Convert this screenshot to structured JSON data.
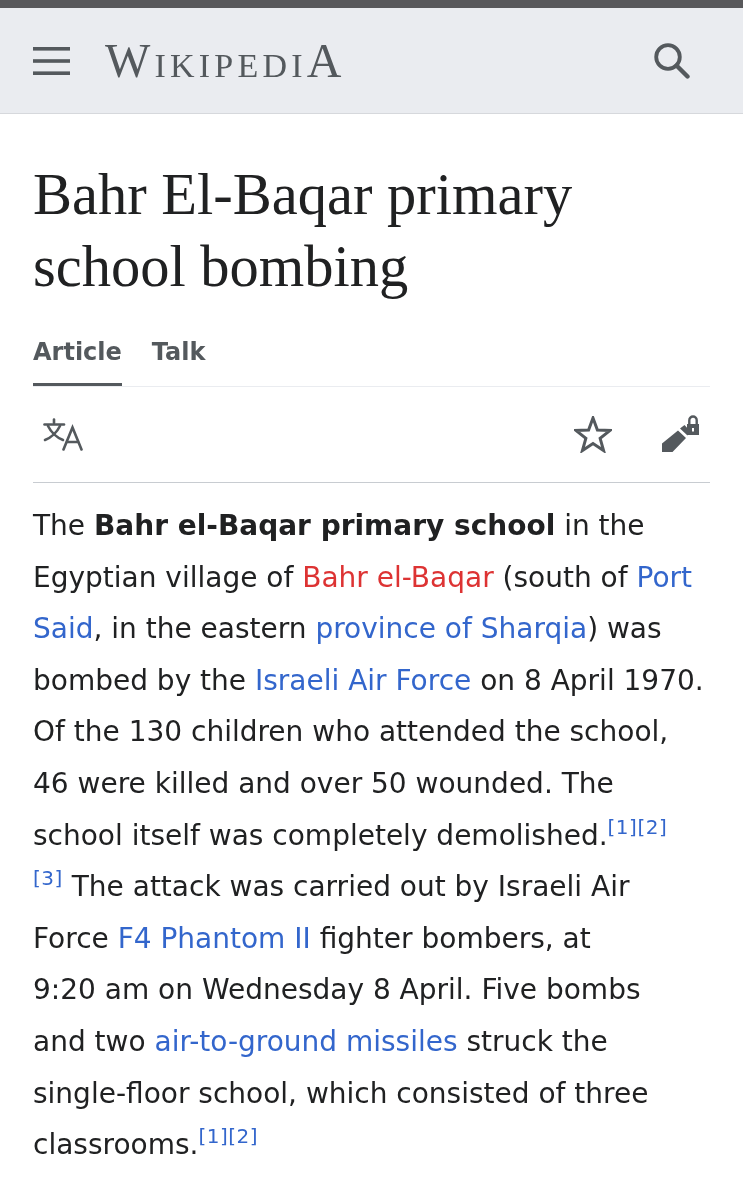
{
  "header": {
    "logo": "WikipediA"
  },
  "title": "Bahr El-Baqar primary school bombing",
  "tabs": [
    {
      "label": "Article",
      "selected": true
    },
    {
      "label": "Talk",
      "selected": false
    }
  ],
  "paragraph": [
    {
      "kind": "text",
      "text": "The **Bahr el-Baqar primary school** in the Egyptian village of "
    },
    {
      "kind": "redlink",
      "text": "Bahr el-Baqar"
    },
    {
      "kind": "text",
      "text": " (south of "
    },
    {
      "kind": "link",
      "lines": [
        "Port",
        "Said"
      ]
    },
    {
      "kind": "text",
      "text": ", in the eastern "
    },
    {
      "kind": "link",
      "lines": [
        "province of Sharqia"
      ]
    },
    {
      "kind": "text",
      "text": ") was bombed by the "
    },
    {
      "kind": "link",
      "lines": [
        "Israeli Air Force"
      ]
    },
    {
      "kind": "text",
      "text": " on 8 April 1970. Of the 130 children who attended the school, 46 were killed and over 50 wounded. The school itself was completely demolished."
    },
    {
      "kind": "ref",
      "text": "[1]"
    },
    {
      "kind": "ref",
      "text": "[2]"
    },
    {
      "kind": "ref",
      "text": "[3]"
    },
    {
      "kind": "text",
      "text": " The attack was carried out by Israeli Air Force "
    },
    {
      "kind": "link",
      "lines": [
        "F4 Phantom II"
      ]
    },
    {
      "kind": "text",
      "text": " fighter bombers, at 9:20 am on Wednesday 8 April. Five bombs and two "
    },
    {
      "kind": "link",
      "lines": [
        "air-to-ground missiles"
      ]
    },
    {
      "kind": "text",
      "text": " struck the single-floor school, which consisted of three classrooms."
    },
    {
      "kind": "ref",
      "text": "[1]"
    },
    {
      "kind": "ref",
      "text": "[2]"
    }
  ]
}
